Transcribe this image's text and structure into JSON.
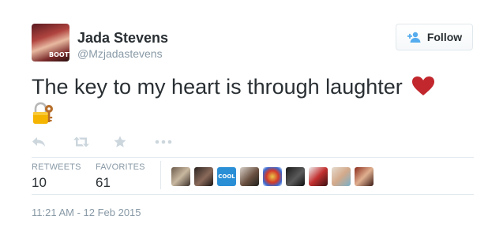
{
  "author": {
    "name": "Jada Stevens",
    "handle": "@Mzjadastevens",
    "avatar_text": "BOOTY"
  },
  "follow_button": {
    "label": "Follow",
    "icon": "add-user-icon"
  },
  "tweet": {
    "text": "The key to my heart is through laughter",
    "emoji": [
      "red-heart",
      "lock-with-key"
    ]
  },
  "actions": [
    "reply-icon",
    "retweet-icon",
    "favorite-star-icon",
    "more-icon"
  ],
  "stats": {
    "retweets_label": "RETWEETS",
    "retweets": "10",
    "favorites_label": "FAVORITES",
    "favorites": "61"
  },
  "favoriters_badge_text": "COOL",
  "timestamp": "11:21 AM - 12 Feb 2015",
  "colors": {
    "text": "#292f33",
    "muted": "#8899a6",
    "border": "#e1e8ed",
    "twitter_blue": "#55acee",
    "heart": "#c1272d"
  }
}
